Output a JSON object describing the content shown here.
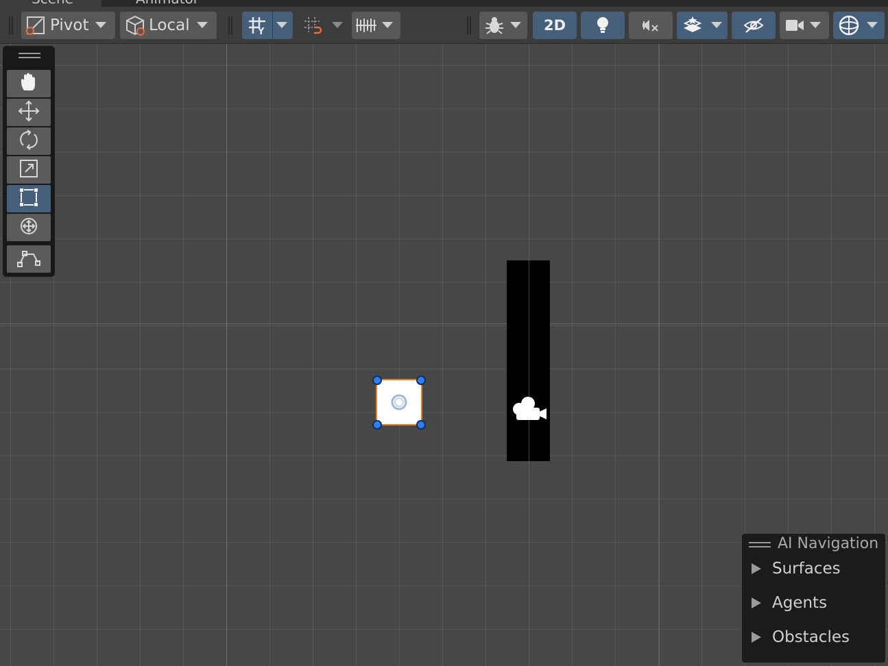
{
  "tabs": [
    {
      "label": "Scene"
    },
    {
      "label": "Animator"
    }
  ],
  "toolbar": {
    "pivot_label": "Pivot",
    "local_label": "Local",
    "mode_2d_label": "2D"
  },
  "tools": {
    "items": [
      "hand-tool",
      "move-tool",
      "rotate-tool",
      "scale-tool",
      "rect-tool",
      "transform-tool",
      "custom-editor-tool"
    ],
    "active": "rect-tool"
  },
  "ai_navigation": {
    "title": "AI Navigation",
    "items": [
      {
        "label": "Surfaces"
      },
      {
        "label": "Agents"
      },
      {
        "label": "Obstacles"
      }
    ]
  },
  "colors": {
    "active_button": "#46607c",
    "selection_outline": "#f07a20",
    "rect_handle": "#2d7ff2"
  }
}
